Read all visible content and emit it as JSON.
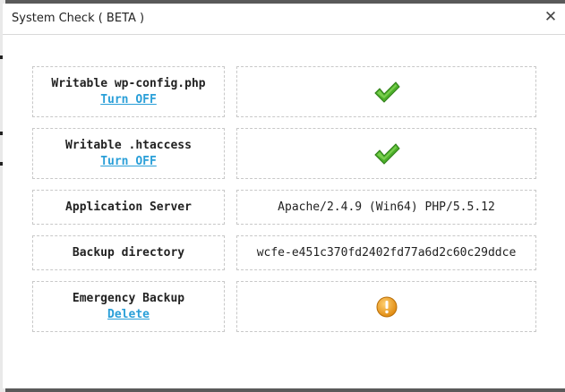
{
  "dialog": {
    "title": "System Check ( BETA )",
    "close_icon": "close-icon",
    "close_glyph": "✕"
  },
  "rows": [
    {
      "label": "Writable wp-config.php",
      "action": "Turn OFF",
      "status_icon": "check-icon"
    },
    {
      "label": "Writable .htaccess",
      "action": "Turn OFF",
      "status_icon": "check-icon"
    },
    {
      "label": "Application Server",
      "value": "Apache/2.4.9 (Win64) PHP/5.5.12"
    },
    {
      "label": "Backup directory",
      "value": "wcfe-e451c370fd2402fd77a6d2c60c29ddce"
    },
    {
      "label": "Emergency Backup",
      "action": "Delete",
      "status_icon": "warning-icon"
    }
  ],
  "colors": {
    "link": "#2a9fd8",
    "check": "#4caf2a",
    "warning": "#f0a020",
    "overlay": "#5a5a5a"
  }
}
